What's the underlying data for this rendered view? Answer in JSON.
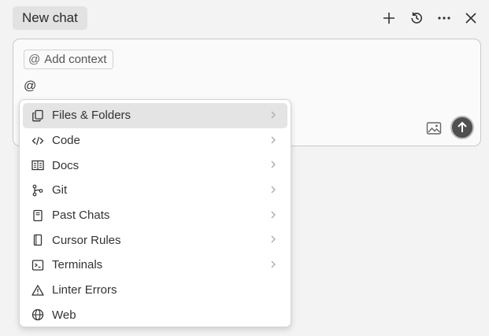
{
  "header": {
    "tab_label": "New chat",
    "actions": [
      {
        "name": "new-chat-button",
        "icon": "plus-icon"
      },
      {
        "name": "history-button",
        "icon": "history-icon"
      },
      {
        "name": "more-button",
        "icon": "ellipsis-icon"
      },
      {
        "name": "close-button",
        "icon": "close-icon"
      }
    ]
  },
  "composer": {
    "context_chip": {
      "symbol": "@",
      "label": "Add context"
    },
    "input_value": "@"
  },
  "menu": {
    "items": [
      {
        "label": "Files & Folders",
        "icon": "files-icon",
        "submenu": true,
        "active": true
      },
      {
        "label": "Code",
        "icon": "code-icon",
        "submenu": true
      },
      {
        "label": "Docs",
        "icon": "book-icon",
        "submenu": true
      },
      {
        "label": "Git",
        "icon": "git-branch-icon",
        "submenu": true
      },
      {
        "label": "Past Chats",
        "icon": "chat-history-icon",
        "submenu": true
      },
      {
        "label": "Cursor Rules",
        "icon": "rules-icon",
        "submenu": true
      },
      {
        "label": "Terminals",
        "icon": "terminal-icon",
        "submenu": true
      },
      {
        "label": "Linter Errors",
        "icon": "warning-icon",
        "submenu": false
      },
      {
        "label": "Web",
        "icon": "globe-icon",
        "submenu": false
      }
    ]
  },
  "colors": {
    "background": "#f3f3f3",
    "tab_bg": "#e2e2e2",
    "active_item_bg": "#e4e4e4",
    "send_button": "#505050"
  }
}
